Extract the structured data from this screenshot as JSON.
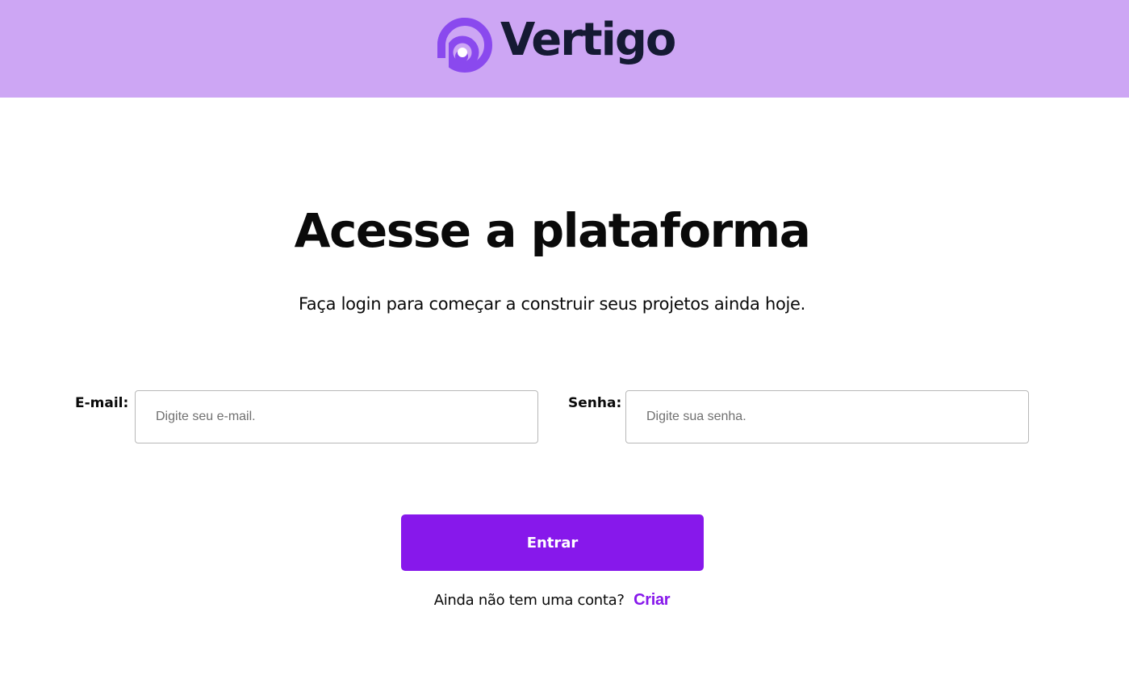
{
  "header": {
    "logo_text": "Vertigo",
    "background_color": "#cda6f4",
    "logo_icon": "vertigo-spiral-icon",
    "logo_icon_color": "#8a49ee"
  },
  "main": {
    "title": "Acesse a plataforma",
    "subtitle": "Faça login para começar a construir seus projetos ainda hoje."
  },
  "form": {
    "email_label": "E-mail:",
    "email_placeholder": "Digite seu e-mail.",
    "email_value": "",
    "password_label": "Senha:",
    "password_placeholder": "Digite sua senha.",
    "password_value": "",
    "submit_label": "Entrar",
    "submit_color": "#8718eb"
  },
  "signup": {
    "prompt": "Ainda não tem uma conta?",
    "link_label": "Criar"
  }
}
